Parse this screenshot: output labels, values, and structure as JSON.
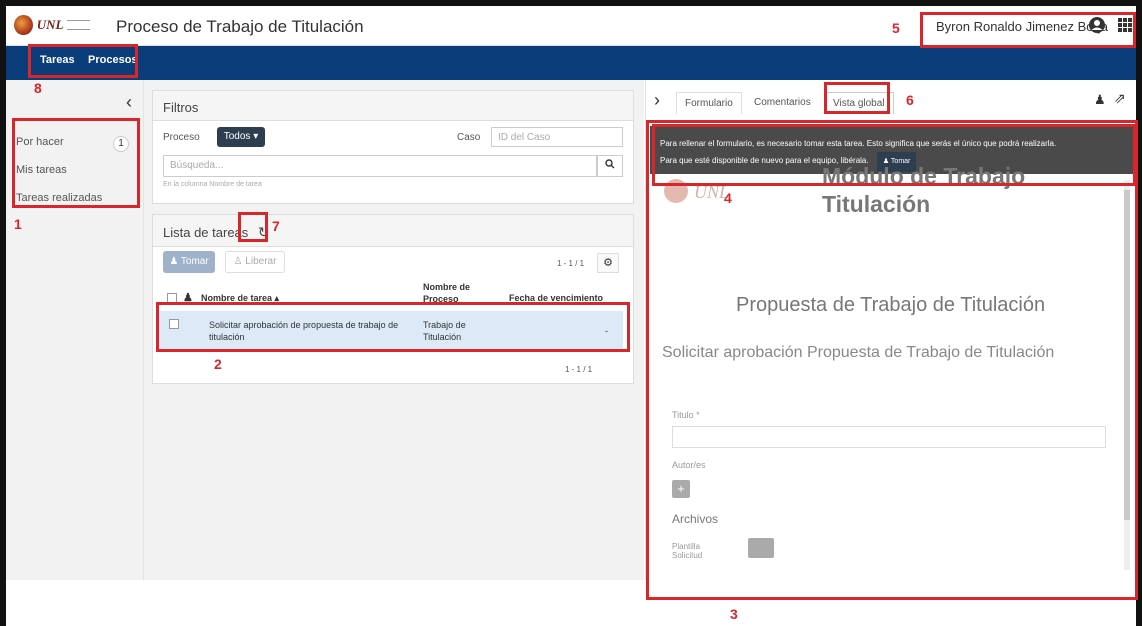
{
  "header": {
    "logo_text": "UNL",
    "title": "Proceso de Trabajo de Titulación",
    "user_name": "Byron Ronaldo Jimenez Borja"
  },
  "nav": {
    "tabs": [
      {
        "label": "Tareas"
      },
      {
        "label": "Procesos"
      }
    ]
  },
  "sidebar": {
    "items": [
      {
        "label": "Por hacer",
        "count": "1"
      },
      {
        "label": "Mis tareas"
      },
      {
        "label": "Tareas realizadas"
      }
    ]
  },
  "filters": {
    "title": "Filtros",
    "proceso_label": "Proceso",
    "proceso_value": "Todos ▾",
    "caso_label": "Caso",
    "caso_placeholder": "ID del Caso",
    "search_placeholder": "Búsqueda...",
    "search_hint": "En la columna Nombre de tarea"
  },
  "task_list": {
    "title": "Lista de tareas",
    "take_label": "Tomar",
    "release_label": "Liberar",
    "pager_top": "1 - 1 / 1",
    "pager_bottom": "1 - 1 / 1",
    "columns": [
      "Nombre de tarea ▴",
      "Nombre de Proceso",
      "Fecha de vencimiento"
    ],
    "rows": [
      {
        "task": "Solicitar aprobación de propuesta de trabajo de titulación",
        "process": "Trabajo de Titulación",
        "due": "-"
      }
    ]
  },
  "right_panel": {
    "tabs": [
      {
        "label": "Formulario"
      },
      {
        "label": "Comentarios"
      },
      {
        "label": "Vista global"
      }
    ],
    "notice_line1": "Para rellenar el formulario, es necesario tomar esta tarea. Esto significa que serás el único que podrá realizarla.",
    "notice_line2": "Para que esté disponible de nuevo para el equipo, libérala.",
    "notice_button": "Tomar",
    "module_title": "Módulo de Trabajo Titulación",
    "proposal_title": "Propuesta de Trabajo de Titulación",
    "request_title": "Solicitar aprobación Propuesta de Trabajo de Titulación",
    "field_title_label": "Titulo *",
    "authors_label": "Autor/es",
    "files_label": "Archivos",
    "template_label": "Plantilla Solicitud"
  },
  "annotations": {
    "labels": [
      "1",
      "2",
      "3",
      "4",
      "5",
      "6",
      "7",
      "8"
    ],
    "color": "#d9262b"
  },
  "colors": {
    "navbar": "#0b3d7a",
    "button_dark": "#2c3e50",
    "selected_row": "#dbeaf6"
  }
}
